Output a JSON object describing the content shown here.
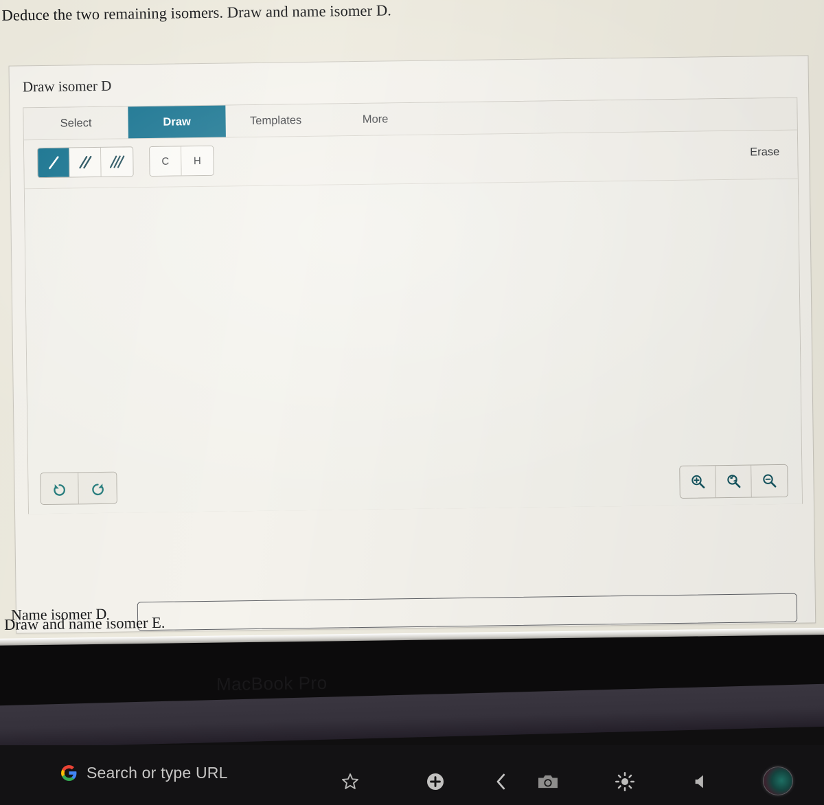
{
  "question": {
    "prompt_top": "Deduce the two remaining isomers. Draw and name isomer D.",
    "prompt_bottom": "Draw and name isomer E."
  },
  "sketcher_card": {
    "title": "Draw isomer D",
    "tabs": [
      {
        "label": "Select",
        "active": false
      },
      {
        "label": "Draw",
        "active": true
      },
      {
        "label": "Templates",
        "active": false
      },
      {
        "label": "More",
        "active": false
      }
    ],
    "toolbar": {
      "bond_tools": [
        {
          "name": "single-bond",
          "active": true
        },
        {
          "name": "double-bond",
          "active": false
        },
        {
          "name": "triple-bond",
          "active": false
        }
      ],
      "atom_tools": [
        {
          "label": "C",
          "active": false
        },
        {
          "label": "H",
          "active": false
        }
      ],
      "erase_label": "Erase"
    },
    "canvas": {
      "content": "",
      "history_buttons": [
        {
          "name": "undo-button",
          "glyph": "undo-arrow-icon"
        },
        {
          "name": "redo-button",
          "glyph": "redo-arrow-icon"
        }
      ],
      "zoom_buttons": [
        {
          "name": "zoom-in-button",
          "glyph": "magnifier-plus-icon"
        },
        {
          "name": "zoom-reset-button",
          "glyph": "magnifier-reset-icon"
        },
        {
          "name": "zoom-out-button",
          "glyph": "magnifier-minus-icon"
        }
      ]
    }
  },
  "name_field": {
    "label": "Name isomer D",
    "value": "",
    "placeholder": ""
  },
  "laptop": {
    "bezel_logo": "MacBook Pro"
  },
  "browser_bar": {
    "omnibox_text": "Search or type URL",
    "icons": [
      {
        "name": "bookmark-star-icon"
      },
      {
        "name": "new-tab-plus-icon"
      },
      {
        "name": "back-chevron-icon"
      },
      {
        "name": "camera-icon"
      },
      {
        "name": "brightness-icon"
      },
      {
        "name": "volume-icon"
      },
      {
        "name": "profile-orb-icon"
      }
    ]
  },
  "colors": {
    "accent_teal": "#0f6f8d",
    "icon_teal": "#1b6b77",
    "screen_bg": "#edeade",
    "card_bg": "#f4f2ec"
  }
}
